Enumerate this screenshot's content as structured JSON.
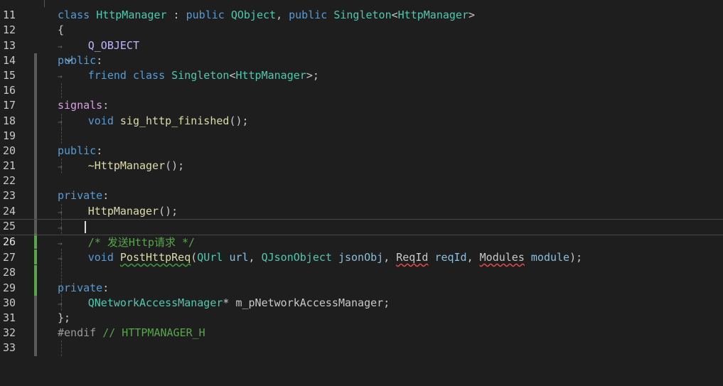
{
  "editor": {
    "lines": [
      {
        "n": "11"
      },
      {
        "n": "12"
      },
      {
        "n": "13"
      },
      {
        "n": "14"
      },
      {
        "n": "15"
      },
      {
        "n": "16"
      },
      {
        "n": "17"
      },
      {
        "n": "18"
      },
      {
        "n": "19"
      },
      {
        "n": "20"
      },
      {
        "n": "21"
      },
      {
        "n": "22"
      },
      {
        "n": "23"
      },
      {
        "n": "24"
      },
      {
        "n": "25"
      },
      {
        "n": "26"
      },
      {
        "n": "27"
      },
      {
        "n": "28"
      },
      {
        "n": "29"
      },
      {
        "n": "30"
      },
      {
        "n": "31"
      },
      {
        "n": "32"
      },
      {
        "n": "33"
      }
    ],
    "tokens": {
      "kw_class": "class",
      "class_name": "HttpManager",
      "colon": " : ",
      "kw_public": "public",
      "qobject": "QObject",
      "comma": ", ",
      "singleton": "Singleton",
      "lt": "<",
      "gt": ">",
      "open_brace": "{",
      "q_object": "Q_OBJECT",
      "public_label": "public",
      "label_colon": ":",
      "kw_friend": "friend",
      "gt_semi": ">;",
      "signals": "signals",
      "kw_void": "void",
      "sig_name": "sig_http_finished",
      "call_semi": "();",
      "dtor": "~HttpManager",
      "private_label": "private",
      "ctor": "HttpManager",
      "comment": "/* 发送Http请求 */",
      "post_fn": "PostHttpReq",
      "open_paren": "(",
      "qurl": "QUrl",
      "url": "url",
      "qjson": "QJsonObject",
      "jsonobj": "jsonObj",
      "reqid_t": "ReqId",
      "reqid": "reqId",
      "modules_t": "Modules",
      "module": "module",
      "close_semi": ");",
      "qnam": "QNetworkAccessManager",
      "star": "*",
      "member": "m_pNetworkAccessManager",
      "semi": ";",
      "close_brace": "};",
      "endif": "#endif",
      "endif_comment": "// HTTPMANAGER_H"
    },
    "fold_icon": "chevron-down-icon",
    "tab_glyph": "→",
    "colors": {
      "background": "#1e1e1e",
      "keyword": "#569cd6",
      "type": "#4ec9b0",
      "function": "#dcdcaa",
      "comment": "#57a64a",
      "changed_marker": "#57a64a"
    }
  }
}
